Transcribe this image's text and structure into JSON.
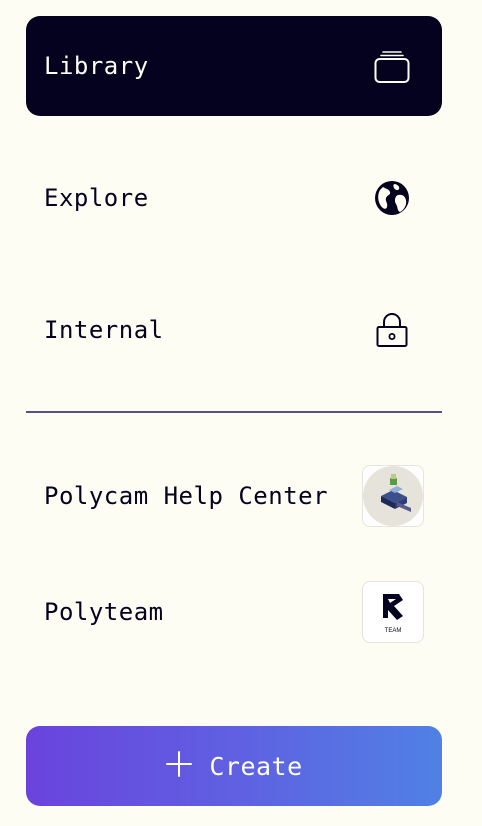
{
  "nav": {
    "items": [
      {
        "label": "Library",
        "icon": "layers-icon",
        "active": true
      },
      {
        "label": "Explore",
        "icon": "globe-icon",
        "active": false
      },
      {
        "label": "Internal",
        "icon": "lock-icon",
        "active": false
      }
    ]
  },
  "links": [
    {
      "label": "Polycam Help Center",
      "icon": "help-center-thumbnail"
    },
    {
      "label": "Polyteam",
      "icon": "polyteam-logo",
      "logo_text": "TEAM"
    }
  ],
  "create": {
    "label": "Create",
    "icon": "plus-icon"
  },
  "colors": {
    "background": "#fdfdf3",
    "active_item": "#05021f",
    "text": "#05021f",
    "divider": "#5a4f84",
    "create_gradient_start": "#6a43dd",
    "create_gradient_end": "#5081e4"
  }
}
